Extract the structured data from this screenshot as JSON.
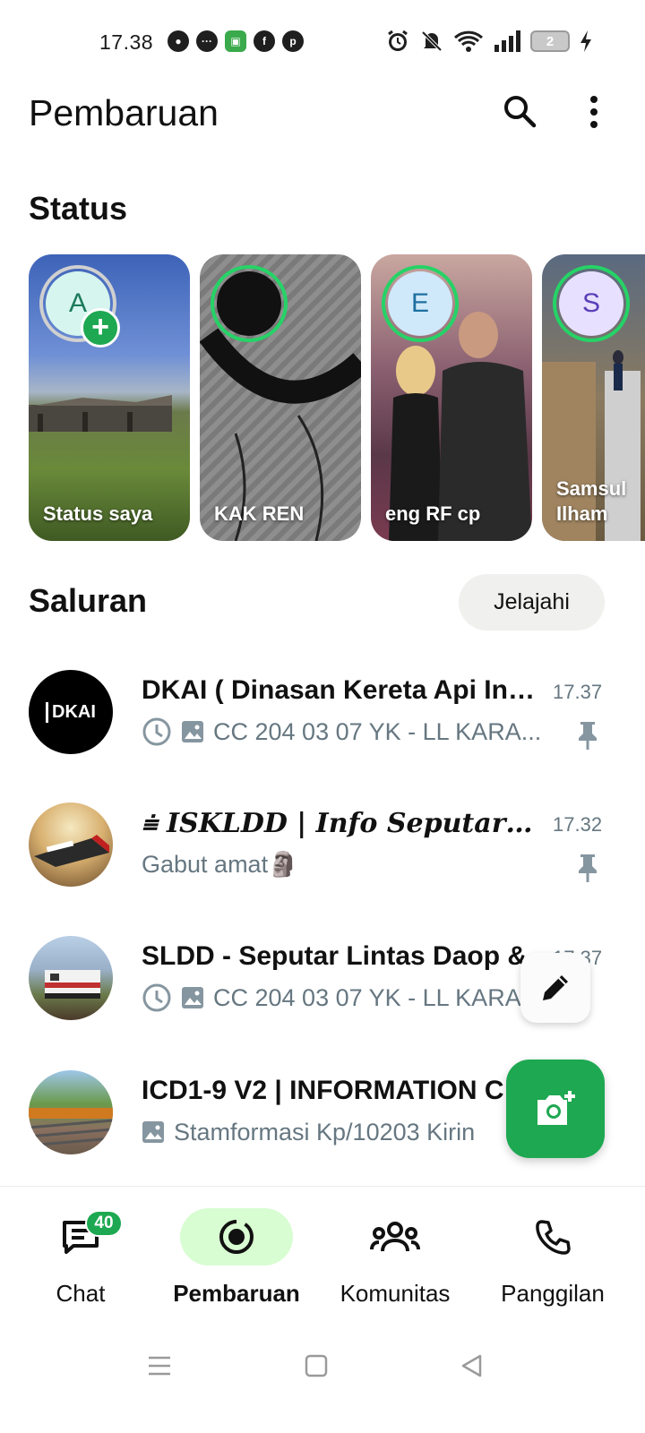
{
  "status_bar": {
    "time": "17.38",
    "battery_level": "2",
    "left_icons": [
      "app-icon",
      "message-icon",
      "notification-icon",
      "facebook-icon",
      "pinterest-icon"
    ],
    "right_icons": [
      "alarm-icon",
      "mute-icon",
      "wifi-icon",
      "signal-icon",
      "battery-icon",
      "charging-icon"
    ]
  },
  "appbar": {
    "title": "Pembaruan"
  },
  "status_section": {
    "title": "Status",
    "cards": [
      {
        "label": "Status saya",
        "initial": "A"
      },
      {
        "label": "KAK REN",
        "initial": ""
      },
      {
        "label": "eng RF cp",
        "initial": "E"
      },
      {
        "label": "Samsul Ilham",
        "initial": "S"
      }
    ]
  },
  "channels_section": {
    "title": "Saluran",
    "explore_label": "Jelajahi",
    "items": [
      {
        "name": "DKAI ( Dinasan Kereta Api Ind...",
        "time": "17.37",
        "preview": "CC 204 03 07 YK - LL KARA...",
        "avatar_text": "DKAI",
        "pinned": true
      },
      {
        "name": "⩧ ISKLDD | Info Seputar Keret...",
        "time": "17.32",
        "preview": "Gabut amat🗿",
        "avatar_text": "",
        "pinned": true
      },
      {
        "name": "SLDD - Seputar Lintas Daop &",
        "time": "17.37",
        "preview": "CC 204 03 07 YK - LL KARA",
        "avatar_text": "",
        "pinned": false
      },
      {
        "name": "ICD1-9 V2 | INFORMATION C",
        "time": "",
        "preview": "Stamformasi Kp/10203 Kirin",
        "avatar_text": "",
        "pinned": false
      }
    ]
  },
  "bottom_nav": {
    "items": [
      {
        "label": "Chat",
        "badge": "40"
      },
      {
        "label": "Pembaruan"
      },
      {
        "label": "Komunitas"
      },
      {
        "label": "Panggilan"
      }
    ]
  },
  "colors": {
    "accent": "#1da851",
    "active_nav_bg": "#d8fdd2",
    "secondary_text": "#667781"
  }
}
